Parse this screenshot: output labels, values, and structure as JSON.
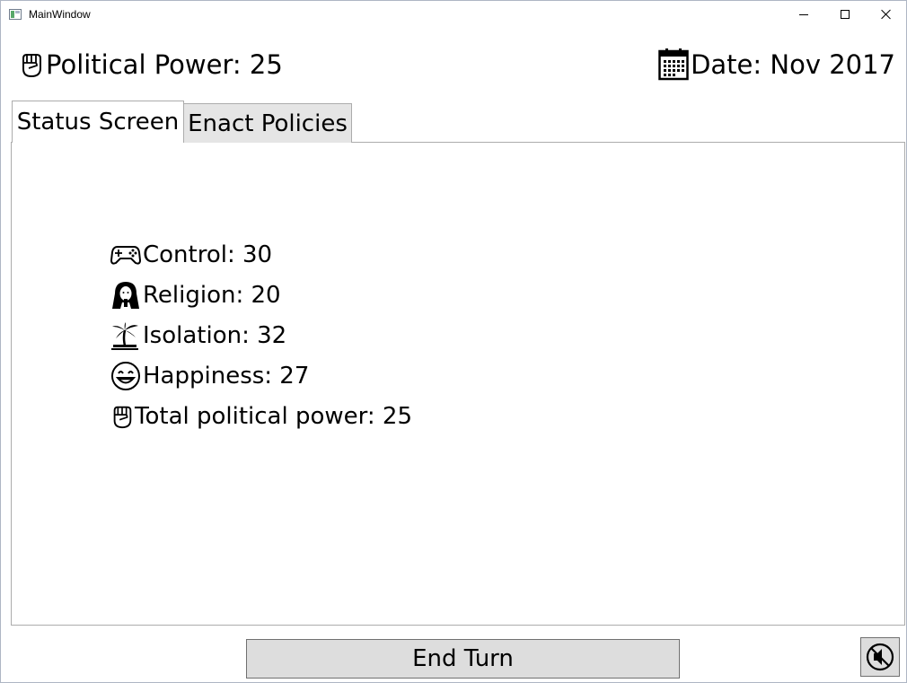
{
  "window": {
    "title": "MainWindow",
    "controls": {
      "minimize": "minimize-icon",
      "maximize": "maximize-icon",
      "close": "close-icon"
    }
  },
  "header": {
    "political_power": "Political Power: 25",
    "political_power_icon": "raised-fist-icon",
    "date": "Date: Nov 2017",
    "date_icon": "calendar-icon"
  },
  "tabs": [
    {
      "label": "Status Screen",
      "selected": true
    },
    {
      "label": "Enact Policies",
      "selected": false
    }
  ],
  "status": {
    "stats": [
      {
        "label": "Control: 30",
        "icon": "gamepad-icon"
      },
      {
        "label": "Religion: 20",
        "icon": "nun-icon"
      },
      {
        "label": "Isolation: 32",
        "icon": "island-icon"
      },
      {
        "label": "Happiness: 27",
        "icon": "smiley-icon"
      },
      {
        "label": "Total political power: 25",
        "icon": "raised-fist-icon"
      }
    ]
  },
  "footer": {
    "end_turn_label": "End Turn",
    "mute_icon": "mute-icon"
  },
  "colors": {
    "tab_border": "#acacac",
    "inactive_tab": "#e5e5e5",
    "button_face": "#dddddd",
    "button_border": "#707070"
  }
}
